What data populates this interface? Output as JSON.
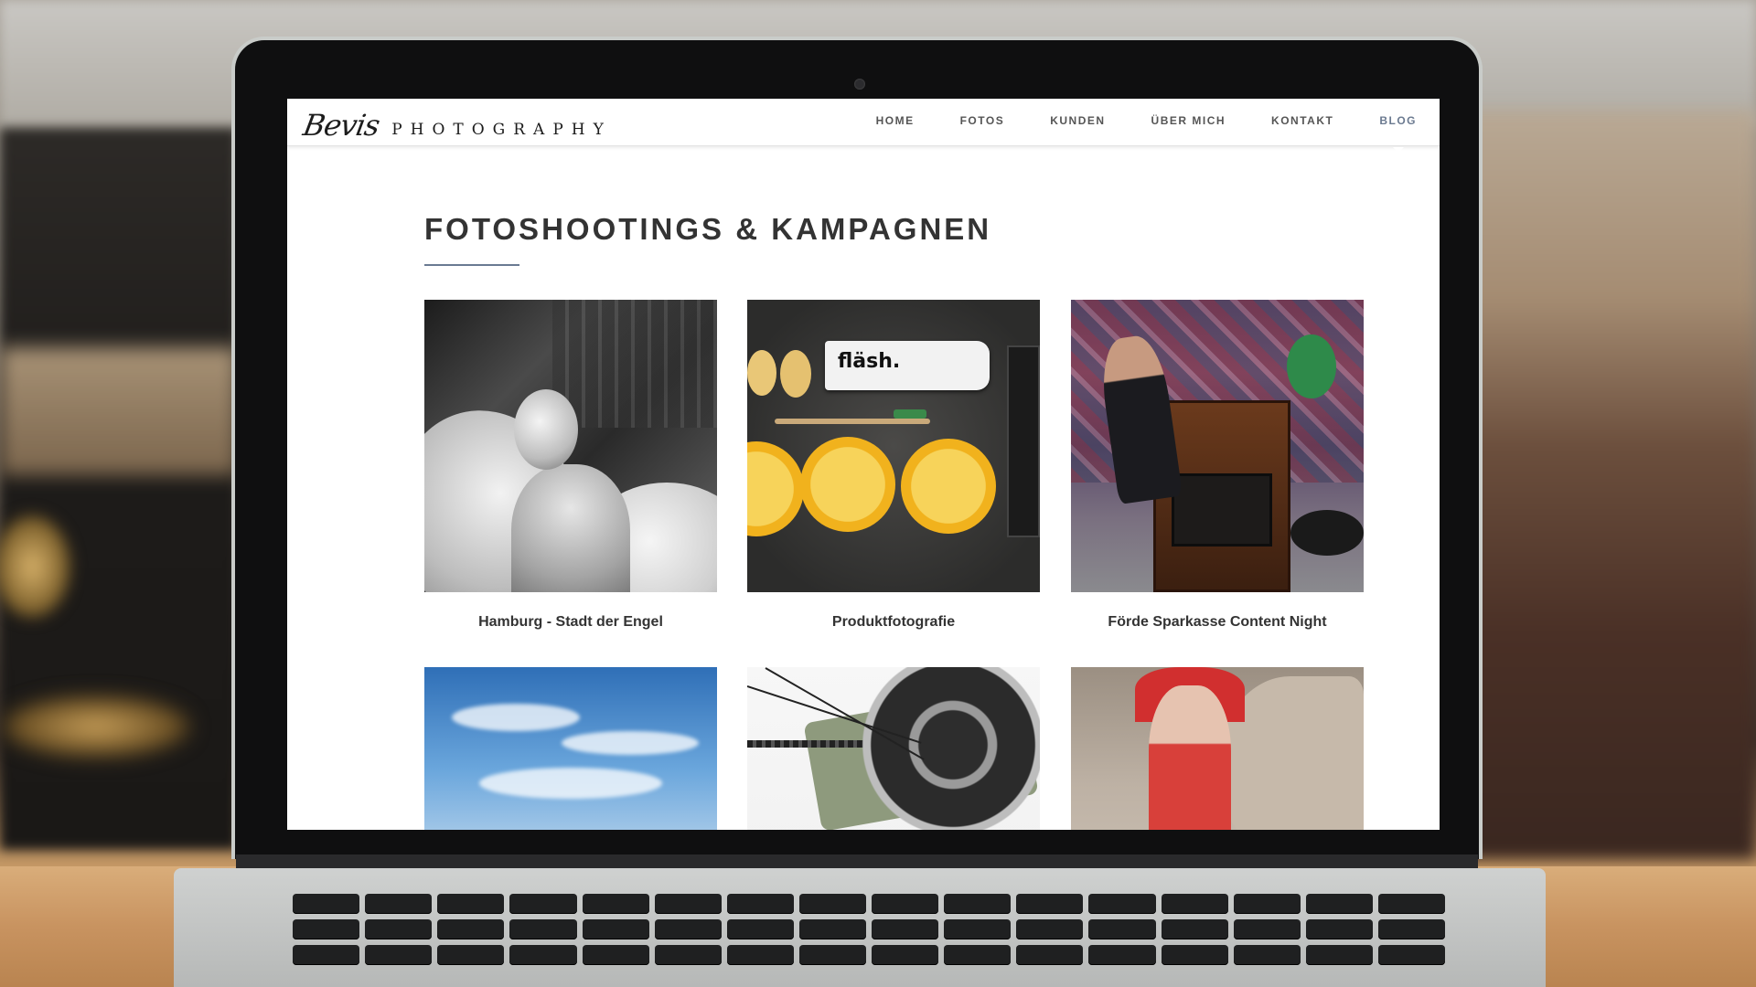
{
  "site": {
    "logo_script": "Bevis",
    "logo_word": "PHOTOGRAPHY"
  },
  "nav": {
    "items": [
      {
        "label": "HOME"
      },
      {
        "label": "FOTOS"
      },
      {
        "label": "KUNDEN"
      },
      {
        "label": "ÜBER MICH"
      },
      {
        "label": "KONTAKT"
      },
      {
        "label": "BLOG"
      }
    ],
    "active": "BLOG"
  },
  "page": {
    "title": "FOTOSHOOTINGS & KAMPAGNEN"
  },
  "gallery": {
    "cards": [
      {
        "caption": "Hamburg - Stadt der Engel",
        "icon": "angel-photo"
      },
      {
        "caption": "Produktfotografie",
        "icon": "toothpaste-product-photo"
      },
      {
        "caption": "Förde Sparkasse Content Night",
        "icon": "scrapyard-photo"
      },
      {
        "caption": "",
        "icon": "sky-photo"
      },
      {
        "caption": "",
        "icon": "bicycle-photo"
      },
      {
        "caption": "",
        "icon": "costume-portrait-photo"
      }
    ],
    "product_brand": "fläsh."
  },
  "colors": {
    "accent": "#6a7a92",
    "text": "#333333",
    "nav_text": "#555555"
  }
}
